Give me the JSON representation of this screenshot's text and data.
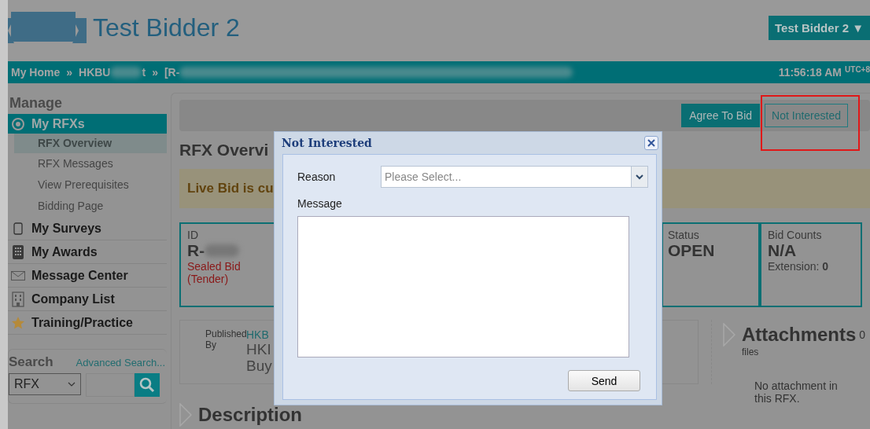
{
  "header": {
    "title": "Test Bidder 2",
    "user_menu": "Test Bidder 2 ▼"
  },
  "breadcrumb": {
    "items": [
      {
        "label": "My Home",
        "redacted": false
      },
      {
        "label": "HKBU",
        "redacted": true,
        "tail": "t"
      },
      {
        "label": "[R-",
        "redacted": true
      }
    ],
    "separators": [
      "»",
      "»"
    ],
    "time": "11:56:18 AM",
    "timezone": "UTC+8"
  },
  "sidebar": {
    "heading": "Manage",
    "items": [
      {
        "label": "My RFXs",
        "selected": true,
        "children": [
          {
            "label": "RFX Overview",
            "selected": true
          },
          {
            "label": "RFX Messages",
            "selected": false
          },
          {
            "label": "View Prerequisites",
            "selected": false
          },
          {
            "label": "Bidding Page",
            "selected": false
          }
        ]
      },
      {
        "label": "My Surveys",
        "selected": false
      },
      {
        "label": "My Awards",
        "selected": false
      },
      {
        "label": "Message Center",
        "selected": false
      },
      {
        "label": "Company List",
        "selected": false
      },
      {
        "label": "Training/Practice",
        "selected": false
      }
    ]
  },
  "search": {
    "label": "Search",
    "advanced_link": "Advanced Search...",
    "scope": "RFX"
  },
  "toolbar": {
    "buttons": [
      {
        "label": "Agree To Bid",
        "kind": "primary",
        "highlighted": false
      },
      {
        "label": "Not Interested",
        "kind": "outline",
        "highlighted": true
      }
    ]
  },
  "page_title": "RFX Overvi",
  "banner": "Live Bid is cu",
  "info": {
    "id": {
      "label": "ID",
      "value": "R-",
      "type": "Sealed Bid (Tender)"
    },
    "status": {
      "label": "Status",
      "value": "OPEN"
    },
    "bid_counts": {
      "label": "Bid Counts",
      "value": "N/A",
      "extension_label": "Extension:",
      "extension_value": "0"
    }
  },
  "published": {
    "label": "Published By",
    "org": "HKB",
    "line_1": "HKI",
    "line_2": "Buy"
  },
  "attachments": {
    "title": "Attachments",
    "count": "0",
    "unit": "files",
    "empty": "No attachment in this RFX."
  },
  "description": {
    "title": "Description"
  },
  "dialog": {
    "title": "Not Interested",
    "reason_label": "Reason",
    "reason_placeholder": "Please Select...",
    "message_label": "Message",
    "send": "Send"
  }
}
